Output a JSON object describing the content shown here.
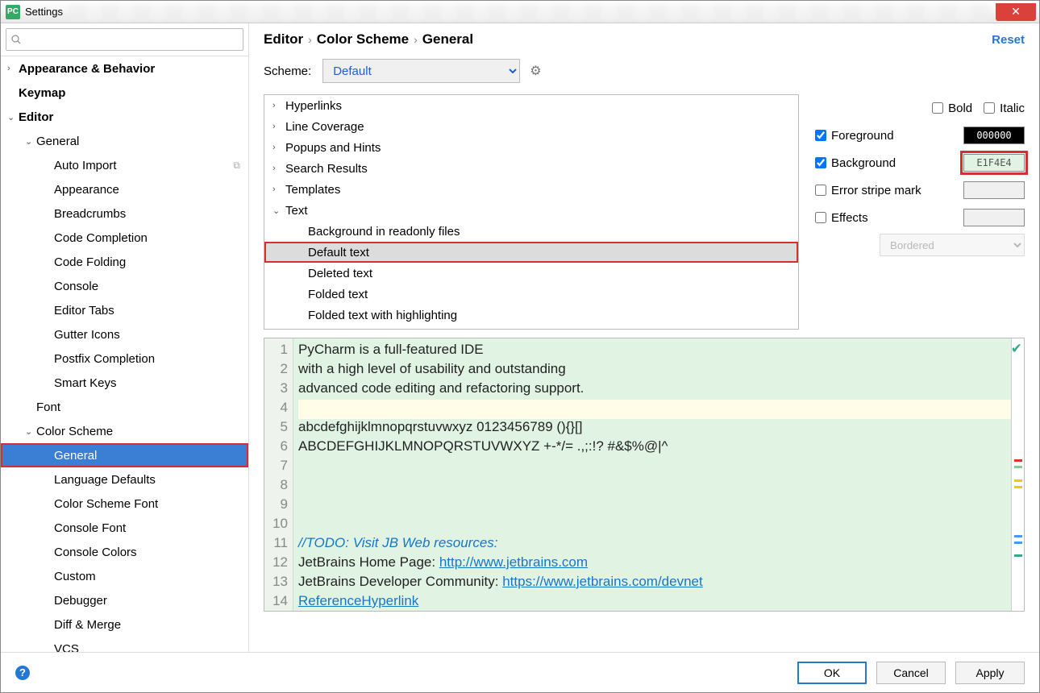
{
  "window": {
    "title": "Settings"
  },
  "sidebar": {
    "search_placeholder": "",
    "items": [
      {
        "label": "Appearance & Behavior",
        "level": 0,
        "chev": "›",
        "bold": true
      },
      {
        "label": "Keymap",
        "level": 0,
        "chev": "",
        "bold": true
      },
      {
        "label": "Editor",
        "level": 0,
        "chev": "⌄",
        "bold": true
      },
      {
        "label": "General",
        "level": 1,
        "chev": "⌄"
      },
      {
        "label": "Auto Import",
        "level": 2,
        "chev": "",
        "copy": true
      },
      {
        "label": "Appearance",
        "level": 2,
        "chev": ""
      },
      {
        "label": "Breadcrumbs",
        "level": 2,
        "chev": ""
      },
      {
        "label": "Code Completion",
        "level": 2,
        "chev": ""
      },
      {
        "label": "Code Folding",
        "level": 2,
        "chev": ""
      },
      {
        "label": "Console",
        "level": 2,
        "chev": ""
      },
      {
        "label": "Editor Tabs",
        "level": 2,
        "chev": ""
      },
      {
        "label": "Gutter Icons",
        "level": 2,
        "chev": ""
      },
      {
        "label": "Postfix Completion",
        "level": 2,
        "chev": ""
      },
      {
        "label": "Smart Keys",
        "level": 2,
        "chev": ""
      },
      {
        "label": "Font",
        "level": 1,
        "chev": ""
      },
      {
        "label": "Color Scheme",
        "level": 1,
        "chev": "⌄"
      },
      {
        "label": "General",
        "level": 2,
        "chev": "",
        "selected": true,
        "highlight": true
      },
      {
        "label": "Language Defaults",
        "level": 2,
        "chev": ""
      },
      {
        "label": "Color Scheme Font",
        "level": 2,
        "chev": ""
      },
      {
        "label": "Console Font",
        "level": 2,
        "chev": ""
      },
      {
        "label": "Console Colors",
        "level": 2,
        "chev": ""
      },
      {
        "label": "Custom",
        "level": 2,
        "chev": ""
      },
      {
        "label": "Debugger",
        "level": 2,
        "chev": ""
      },
      {
        "label": "Diff & Merge",
        "level": 2,
        "chev": ""
      },
      {
        "label": "VCS",
        "level": 2,
        "chev": ""
      }
    ]
  },
  "breadcrumb": {
    "a": "Editor",
    "b": "Color Scheme",
    "c": "General",
    "reset": "Reset"
  },
  "scheme": {
    "label": "Scheme:",
    "value": "Default"
  },
  "attrTree": [
    {
      "chev": "›",
      "label": "Hyperlinks",
      "indent": 0
    },
    {
      "chev": "›",
      "label": "Line Coverage",
      "indent": 0
    },
    {
      "chev": "›",
      "label": "Popups and Hints",
      "indent": 0
    },
    {
      "chev": "›",
      "label": "Search Results",
      "indent": 0
    },
    {
      "chev": "›",
      "label": "Templates",
      "indent": 0
    },
    {
      "chev": "⌄",
      "label": "Text",
      "indent": 0
    },
    {
      "chev": "",
      "label": "Background in readonly files",
      "indent": 1
    },
    {
      "chev": "",
      "label": "Default text",
      "indent": 1,
      "selected": true,
      "highlight": true
    },
    {
      "chev": "",
      "label": "Deleted text",
      "indent": 1
    },
    {
      "chev": "",
      "label": "Folded text",
      "indent": 1
    },
    {
      "chev": "",
      "label": "Folded text with highlighting",
      "indent": 1
    }
  ],
  "opts": {
    "bold": "Bold",
    "italic": "Italic",
    "fg": "Foreground",
    "fg_val": "000000",
    "bg": "Background",
    "bg_val": "E1F4E4",
    "stripe": "Error stripe mark",
    "effects": "Effects",
    "effects_type": "Bordered"
  },
  "preview": {
    "lines": [
      "PyCharm is a full-featured IDE",
      "with a high level of usability and outstanding",
      "advanced code editing and refactoring support.",
      "",
      "abcdefghijklmnopqrstuvwxyz 0123456789 (){}[]",
      "ABCDEFGHIJKLMNOPQRSTUVWXYZ +-*/= .,;:!? #&$%@|^",
      "",
      "",
      "",
      "",
      "//TODO: Visit JB Web resources:",
      "JetBrains Home Page: ",
      "JetBrains Developer Community: ",
      "ReferenceHyperlink"
    ],
    "link12": "http://www.jetbrains.com",
    "link13": "https://www.jetbrains.com/devnet"
  },
  "footer": {
    "ok": "OK",
    "cancel": "Cancel",
    "apply": "Apply"
  }
}
